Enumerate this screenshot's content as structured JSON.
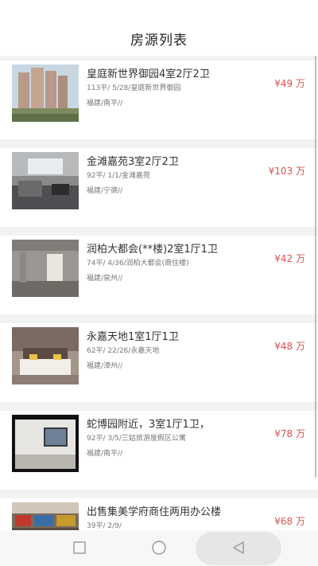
{
  "header": {
    "title": "房源列表"
  },
  "listings": [
    {
      "title": "皇庭新世界御园4室2厅2卫",
      "details": "113平/ 5/28/皇庭新世界御园",
      "location": "福建/南平//",
      "price": "¥49 万"
    },
    {
      "title": "金滩嘉苑3室2厅2卫",
      "details": "92平/ 1/1/金滩嘉苑",
      "location": "福建/宁德//",
      "price": "¥103 万"
    },
    {
      "title": "润柏大都会(**楼)2室1厅1卫",
      "details": "74平/ 4/36/润柏大都会(商住楼)",
      "location": "福建/泉州//",
      "price": "¥42 万"
    },
    {
      "title": "永嘉天地1室1厅1卫",
      "details": "62平/ 22/26/永嘉天地",
      "location": "福建/漳州//",
      "price": "¥48 万"
    },
    {
      "title": "蛇博园附近，3室1厅1卫，",
      "details": "92平/ 3/5/三姑旅游度假区公寓",
      "location": "福建/南平//",
      "price": "¥78 万"
    },
    {
      "title": "出售集美学府商住两用办公楼",
      "details": "39平/ 2/9/",
      "location": "",
      "price": "¥68 万"
    }
  ],
  "navbar": {
    "buttons": [
      "square-icon",
      "circle-icon",
      "back-triangle-icon"
    ]
  }
}
